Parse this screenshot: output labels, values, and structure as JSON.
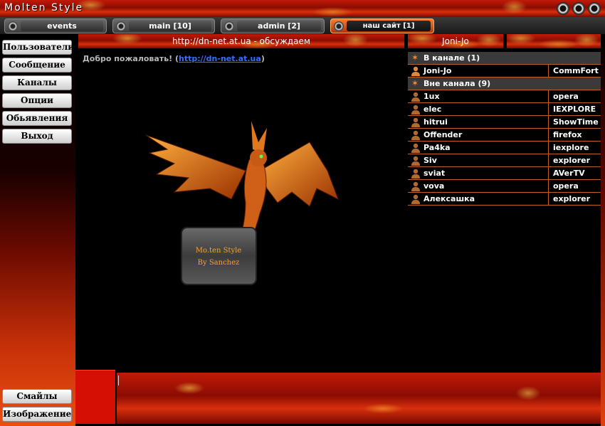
{
  "window": {
    "title": "Molten Style"
  },
  "tabs": [
    {
      "label": "events",
      "active": false
    },
    {
      "label": "main [10]",
      "active": false
    },
    {
      "label": "admin [2]",
      "active": false
    },
    {
      "label": "наш сайт [1]",
      "active": true
    }
  ],
  "sidebar": {
    "items": [
      "Пользователи",
      "Сообщение",
      "Каналы",
      "Опции",
      "Обьявления",
      "Выход"
    ],
    "bottom_items": [
      "Смайлы",
      "Изображение"
    ]
  },
  "header": {
    "topic": "http://dn-net.at.ua - обсуждаем",
    "nick": "Joni-Jo",
    "extra": ""
  },
  "chat": {
    "welcome_text": "Добро пожаловать! (",
    "welcome_link": "http://dn-net.at.ua",
    "welcome_end": ")",
    "image_caption_line1": "Mo.ten Style",
    "image_caption_line2": "By Sanchez"
  },
  "userlist": {
    "in_channel_label": "В канале (1)",
    "in_channel": [
      {
        "name": "Joni-Jo",
        "client": "CommFort"
      }
    ],
    "out_channel_label": "Вне канала (9)",
    "out_channel": [
      {
        "name": "1ux",
        "client": "opera"
      },
      {
        "name": "elec",
        "client": "IEXPLORE"
      },
      {
        "name": "hitrui",
        "client": "ShowTime"
      },
      {
        "name": "Offender",
        "client": "firefox"
      },
      {
        "name": "Pa4ka",
        "client": "iexplore"
      },
      {
        "name": "Siv",
        "client": "explorer"
      },
      {
        "name": "sviat",
        "client": "AVerTV"
      },
      {
        "name": "vova",
        "client": "opera"
      },
      {
        "name": "Алексашка",
        "client": "explorer"
      }
    ]
  },
  "colors": {
    "accent": "#c06020",
    "link": "#3a6cff",
    "fire": "#c21a08"
  },
  "icons": {
    "group": "star-icon",
    "user": "user-icon"
  }
}
